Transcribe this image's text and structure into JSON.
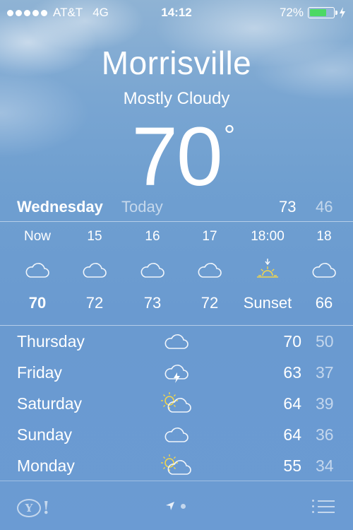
{
  "status": {
    "carrier": "AT&T",
    "network": "4G",
    "time": "14:12",
    "battery": "72%",
    "battery_level": 0.72,
    "battery_color": "#4cd964"
  },
  "weather": {
    "city": "Morrisville",
    "condition": "Mostly Cloudy",
    "temp": "70",
    "degree": "°"
  },
  "today": {
    "day": "Wednesday",
    "label": "Today",
    "high": "73",
    "low": "46"
  },
  "hourly": [
    {
      "time": "Now",
      "icon": "cloud-icon",
      "value": "70"
    },
    {
      "time": "15",
      "icon": "cloud-icon",
      "value": "72"
    },
    {
      "time": "16",
      "icon": "cloud-icon",
      "value": "73"
    },
    {
      "time": "17",
      "icon": "cloud-icon",
      "value": "72"
    },
    {
      "time": "18:00",
      "icon": "sunset-icon",
      "value": "Sunset"
    },
    {
      "time": "18",
      "icon": "cloud-icon",
      "value": "66"
    }
  ],
  "daily": [
    {
      "day": "Thursday",
      "icon": "cloud-icon",
      "high": "70",
      "low": "50"
    },
    {
      "day": "Friday",
      "icon": "thunderstorm-icon",
      "high": "63",
      "low": "37"
    },
    {
      "day": "Saturday",
      "icon": "partly-sunny-icon",
      "high": "64",
      "low": "39"
    },
    {
      "day": "Sunday",
      "icon": "cloud-icon",
      "high": "64",
      "low": "36"
    },
    {
      "day": "Monday",
      "icon": "partly-sunny-icon",
      "high": "55",
      "low": "34"
    }
  ],
  "colors": {
    "sun": "#f2d64b",
    "muted": "rgba(255,255,255,0.6)"
  }
}
